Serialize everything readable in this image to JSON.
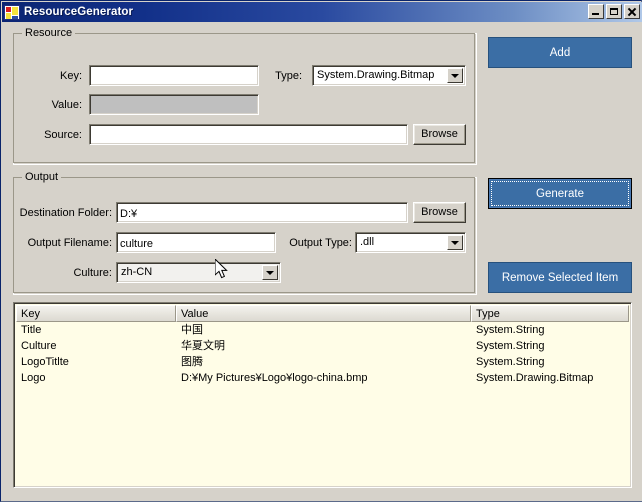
{
  "window": {
    "title": "ResourceGenerator",
    "icon": "app-resource-icon",
    "controls": {
      "minimize": "_",
      "maximize": "□",
      "close": "×"
    }
  },
  "resource_group": {
    "title": "Resource",
    "key_label": "Key:",
    "key_value": "",
    "value_label": "Value:",
    "value_value": "",
    "source_label": "Source:",
    "source_value": "",
    "type_label": "Type:",
    "type_value": "System.Drawing.Bitmap",
    "browse_label": "Browse"
  },
  "output_group": {
    "title": "Output",
    "destination_label": "Destination Folder:",
    "destination_value": "D:¥",
    "destination_browse_label": "Browse",
    "filename_label": "Output Filename:",
    "filename_value": "culture",
    "output_type_label": "Output Type:",
    "output_type_value": ".dll",
    "culture_label": "Culture:",
    "culture_value": "zh-CN"
  },
  "actions": {
    "add_label": "Add",
    "generate_label": "Generate",
    "remove_label": "Remove Selected Item"
  },
  "listview": {
    "columns": [
      "Key",
      "Value",
      "Type"
    ],
    "rows": [
      {
        "key": "Title",
        "value": "中国",
        "type": "System.String"
      },
      {
        "key": "Culture",
        "value": "华夏文明",
        "type": "System.String"
      },
      {
        "key": "LogoTitlte",
        "value": "图腾",
        "type": "System.String"
      },
      {
        "key": "Logo",
        "value": "D:¥My Pictures¥Logo¥logo-china.bmp",
        "type": "System.Drawing.Bitmap"
      }
    ]
  },
  "colors": {
    "form_background": "#d6d2ca",
    "title_gradient_start": "#0b2573",
    "title_gradient_end": "#b0c8e8",
    "button_blue": "#3b6ea5",
    "listview_background": "#fffde7",
    "field_disabled": "#bfbfbf"
  }
}
